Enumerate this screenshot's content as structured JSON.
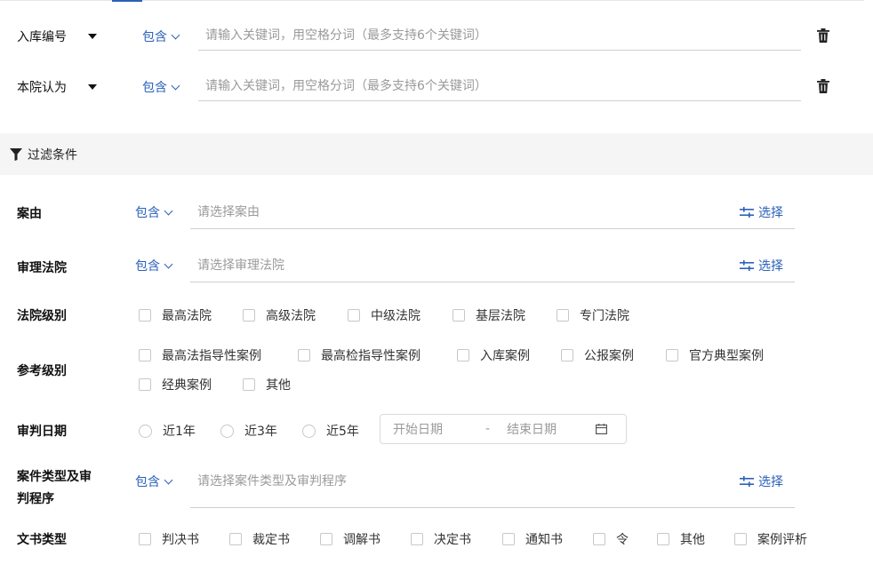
{
  "keyword_rows": [
    {
      "field": "入库编号",
      "match": "包含",
      "placeholder": "请输入关键词，用空格分词（最多支持6个关键词）"
    },
    {
      "field": "本院认为",
      "match": "包含",
      "placeholder": "请输入关键词，用空格分词（最多支持6个关键词）"
    }
  ],
  "filter_header": {
    "title": "过滤条件"
  },
  "filters": {
    "cause": {
      "label": "案由",
      "match": "包含",
      "placeholder": "请选择案由",
      "select": "选择"
    },
    "court": {
      "label": "审理法院",
      "match": "包含",
      "placeholder": "请选择审理法院",
      "select": "选择"
    },
    "court_level": {
      "label": "法院级别",
      "options": [
        "最高法院",
        "高级法院",
        "中级法院",
        "基层法院",
        "专门法院"
      ]
    },
    "ref_level": {
      "label": "参考级别",
      "options": [
        "最高法指导性案例",
        "最高检指导性案例",
        "入库案例",
        "公报案例",
        "官方典型案例",
        "经典案例",
        "其他"
      ]
    },
    "judge_date": {
      "label": "审判日期",
      "options": [
        "近1年",
        "近3年",
        "近5年"
      ],
      "start_placeholder": "开始日期",
      "separator": "-",
      "end_placeholder": "结束日期"
    },
    "case_type": {
      "label_line1": "案件类型及审",
      "label_line2": "判程序",
      "match": "包含",
      "placeholder": "请选择案件类型及审判程序",
      "select": "选择"
    },
    "doc_type": {
      "label": "文书类型",
      "options": [
        "判决书",
        "裁定书",
        "调解书",
        "决定书",
        "通知书",
        "令",
        "其他",
        "案例评析"
      ]
    }
  }
}
